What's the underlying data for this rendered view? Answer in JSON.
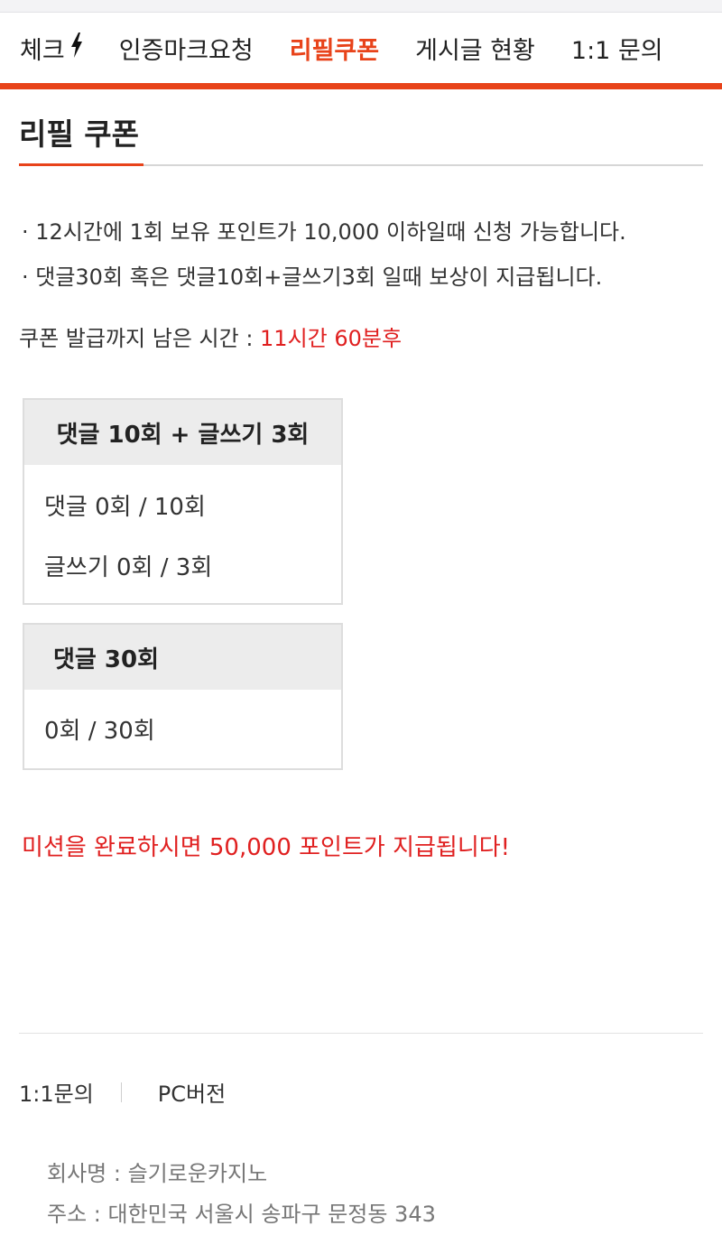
{
  "nav": {
    "items": [
      {
        "label": "체크"
      },
      {
        "label": "인증마크요청"
      },
      {
        "label": "리필쿠폰"
      },
      {
        "label": "게시글 현황"
      },
      {
        "label": "1:1 문의"
      }
    ],
    "active_index": 2,
    "accent_color": "#e8431a"
  },
  "page": {
    "title": "리필 쿠폰"
  },
  "notes": [
    "· 12시간에 1회 보유 포인트가 10,000 이하일때 신청 가능합니다.",
    "· 댓글30회 혹은 댓글10회+글쓰기3회 일때 보상이 지급됩니다."
  ],
  "remaining": {
    "label": "쿠폰 발급까지 남은 시간 : ",
    "value": "11시간 60분후"
  },
  "missions": [
    {
      "title": "댓글 10회 + 글쓰기 3회",
      "rows": [
        "댓글 0회 / 10회",
        "글쓰기 0회 / 3회"
      ]
    },
    {
      "title": "댓글 30회",
      "rows": [
        "0회 / 30회"
      ]
    }
  ],
  "reward_text": "미션을 완료하시면 50,000 포인트가 지급됩니다!",
  "footer": {
    "links": [
      "1:1문의",
      "PC버전"
    ],
    "company": "회사명 : 슬기로운카지노",
    "address": "주소 : 대한민국 서울시 송파구 문정동 343"
  },
  "colors": {
    "accent": "#e8431a",
    "alert": "#e02020"
  }
}
